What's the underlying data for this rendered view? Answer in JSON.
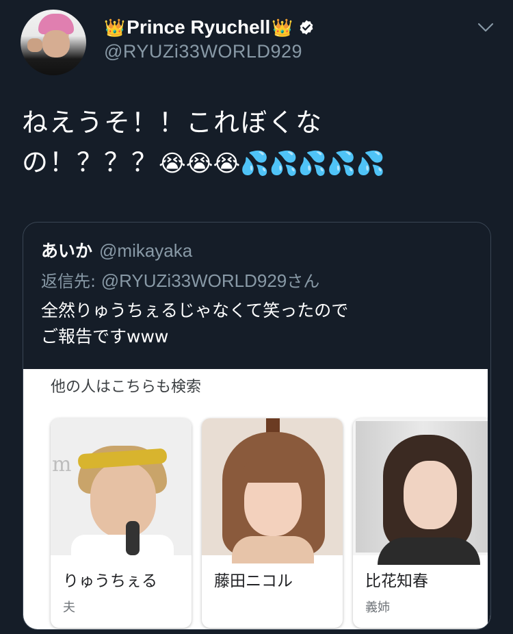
{
  "author": {
    "display_name": "Prince Ryuchell",
    "crown_emoji": "👑",
    "handle": "@RYUZi33WORLD929",
    "verified": true
  },
  "tweet": {
    "line1": "ねえうそ！！これぼくな",
    "line2_text": "の！？？？",
    "line2_emoji": "😭😭😭💦💦💦💦💦"
  },
  "quoted": {
    "name": "あいか",
    "handle": "@mikayaka",
    "reply_prefix": "返信先: ",
    "reply_mention": "@RYUZi33WORLD929",
    "reply_suffix": "さん",
    "text_line1": "全然りゅうちぇるじゃなくて笑ったので",
    "text_line2": "ご報告ですwww",
    "image": {
      "search_title": "他の人はこちらも検索",
      "people": [
        {
          "name": "りゅうちぇる",
          "relation": "夫"
        },
        {
          "name": "藤田ニコル",
          "relation": ""
        },
        {
          "name": "比花知春",
          "relation": "義姉"
        }
      ],
      "logo_fragment": "m"
    }
  },
  "icons": {
    "verified": "verified-badge-icon",
    "menu": "chevron-down-icon"
  },
  "colors": {
    "background": "#151d28",
    "secondary_text": "#8899a6",
    "border": "#3a4654"
  }
}
